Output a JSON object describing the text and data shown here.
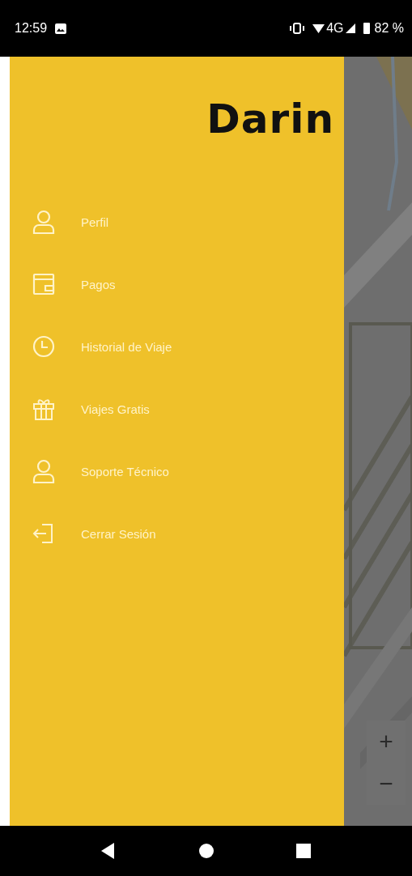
{
  "status_bar": {
    "time": "12:59",
    "network": "4G",
    "battery": "82 %"
  },
  "drawer": {
    "logo": "Darin",
    "items": [
      {
        "label": "Perfil"
      },
      {
        "label": "Pagos"
      },
      {
        "label": "Historial de Viaje"
      },
      {
        "label": "Viajes Gratis"
      },
      {
        "label": "Soporte Técnico"
      },
      {
        "label": "Cerrar Sesión"
      }
    ]
  },
  "map": {
    "kind": "picture",
    "zoom_controls": [
      "+",
      "−"
    ]
  }
}
